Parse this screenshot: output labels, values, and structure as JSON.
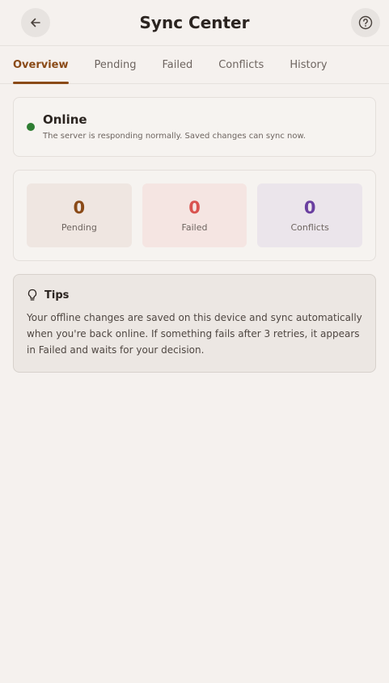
{
  "header": {
    "title": "Sync Center",
    "back_icon": "arrow-left-icon",
    "help_icon": "help-circle-icon"
  },
  "tabs": [
    {
      "label": "Overview",
      "active": true
    },
    {
      "label": "Pending"
    },
    {
      "label": "Failed"
    },
    {
      "label": "Conflicts"
    },
    {
      "label": "History"
    }
  ],
  "status": {
    "title": "Online",
    "description": "The server is responding normally. Saved changes can sync now.",
    "color": "#2e7d32"
  },
  "counts": [
    {
      "value": "0",
      "label": "Pending",
      "color": "#8a4a17"
    },
    {
      "value": "0",
      "label": "Failed",
      "color": "#d9534f"
    },
    {
      "value": "0",
      "label": "Conflicts",
      "color": "#6a3fa0"
    }
  ],
  "tips": {
    "icon": "lightbulb-icon",
    "title": "Tips",
    "body": "Your offline changes are saved on this device and sync automatically when you're back online. If something fails after 3 retries, it appears in Failed and waits for your decision."
  },
  "colors": {
    "accent": "#8a4a17",
    "background": "#f5f1ee"
  }
}
